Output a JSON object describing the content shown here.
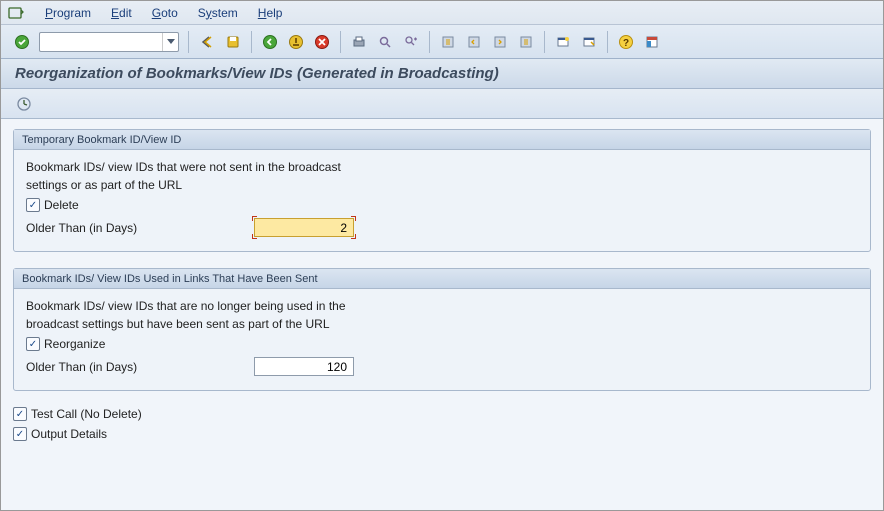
{
  "menubar": {
    "items": [
      {
        "label": "Program",
        "u": "P"
      },
      {
        "label": "Edit",
        "u": "E"
      },
      {
        "label": "Goto",
        "u": "G"
      },
      {
        "label": "System",
        "u": "S"
      },
      {
        "label": "Help",
        "u": "H"
      }
    ]
  },
  "title": "Reorganization of Bookmarks/View IDs (Generated in Broadcasting)",
  "group1": {
    "header": "Temporary Bookmark ID/View ID",
    "desc1": "Bookmark IDs/ view IDs that were not sent in the broadcast",
    "desc2": "settings or as part of the URL",
    "delete_label": "Delete",
    "delete_checked": true,
    "older_label": "Older Than (in Days)",
    "older_value": "2"
  },
  "group2": {
    "header": "Bookmark IDs/ View IDs Used in Links That Have Been Sent",
    "desc1": "Bookmark IDs/ view IDs that are no longer being used in the",
    "desc2": "broadcast settings but have been sent as part of the URL",
    "reorg_label": "Reorganize",
    "reorg_checked": true,
    "older_label": "Older Than (in Days)",
    "older_value": "120"
  },
  "options": {
    "testcall_label": "Test Call (No Delete)",
    "testcall_checked": true,
    "output_label": "Output Details",
    "output_checked": true
  }
}
